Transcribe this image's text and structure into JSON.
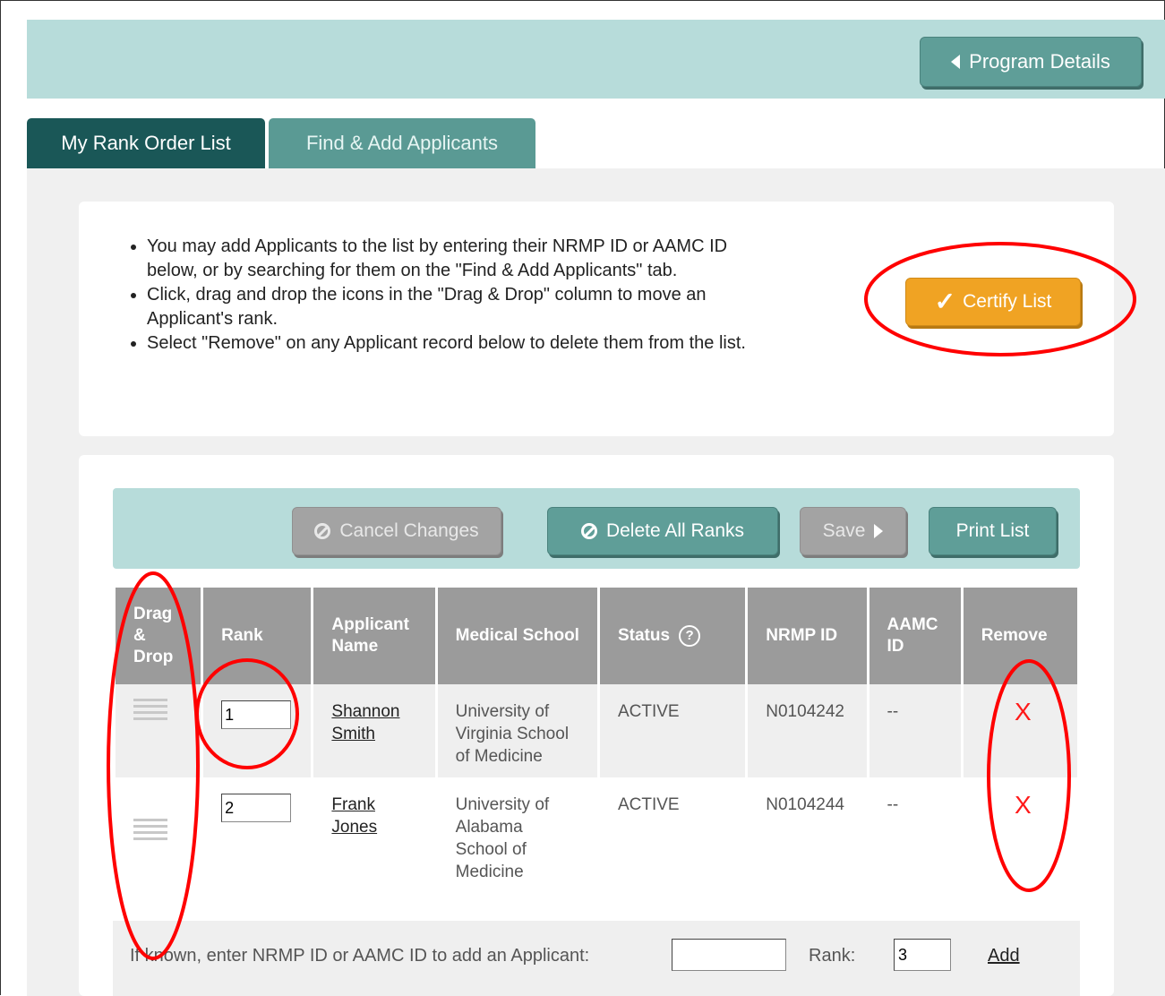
{
  "header": {
    "program_details_label": "Program Details"
  },
  "tabs": [
    {
      "label": "My Rank Order List",
      "active": true
    },
    {
      "label": "Find & Add Applicants",
      "active": false
    }
  ],
  "instructions": [
    "You may add Applicants to the list by entering their NRMP ID or AAMC ID below, or by searching for them on the \"Find & Add Applicants\" tab.",
    "Click, drag and drop the icons in the \"Drag & Drop\" column to move an Applicant's rank.",
    "Select \"Remove\" on any Applicant record below to delete them from the list."
  ],
  "certify_label": "Certify List",
  "toolbar": {
    "cancel_label": "Cancel Changes",
    "delete_all_label": "Delete All Ranks",
    "save_label": "Save",
    "print_label": "Print List"
  },
  "columns": {
    "drag": "Drag & Drop",
    "rank": "Rank",
    "name": "Applicant Name",
    "school": "Medical School",
    "status": "Status",
    "nrmp": "NRMP ID",
    "aamc": "AAMC ID",
    "remove": "Remove"
  },
  "rows": [
    {
      "rank": "1",
      "name": "Shannon Smith",
      "school": "University of Virginia School of Medicine",
      "status": "ACTIVE",
      "nrmp_id": "N0104242",
      "aamc_id": "--",
      "remove": "X"
    },
    {
      "rank": "2",
      "name": "Frank Jones",
      "school": "University of Alabama School of Medicine",
      "status": "ACTIVE",
      "nrmp_id": "N0104244",
      "aamc_id": "--",
      "remove": "X"
    }
  ],
  "add_applicant": {
    "label": "If known, enter NRMP ID or AAMC ID to add an Applicant:",
    "id_value": "",
    "rank_label": "Rank:",
    "rank_value": "3",
    "add_label": "Add"
  },
  "colors": {
    "teal_dark": "#1a5757",
    "teal": "#5f9e98",
    "teal_light": "#b7dcda",
    "certify_orange": "#f0a323",
    "annotation_red": "#ff0000",
    "remove_red": "#ff1a1a"
  }
}
